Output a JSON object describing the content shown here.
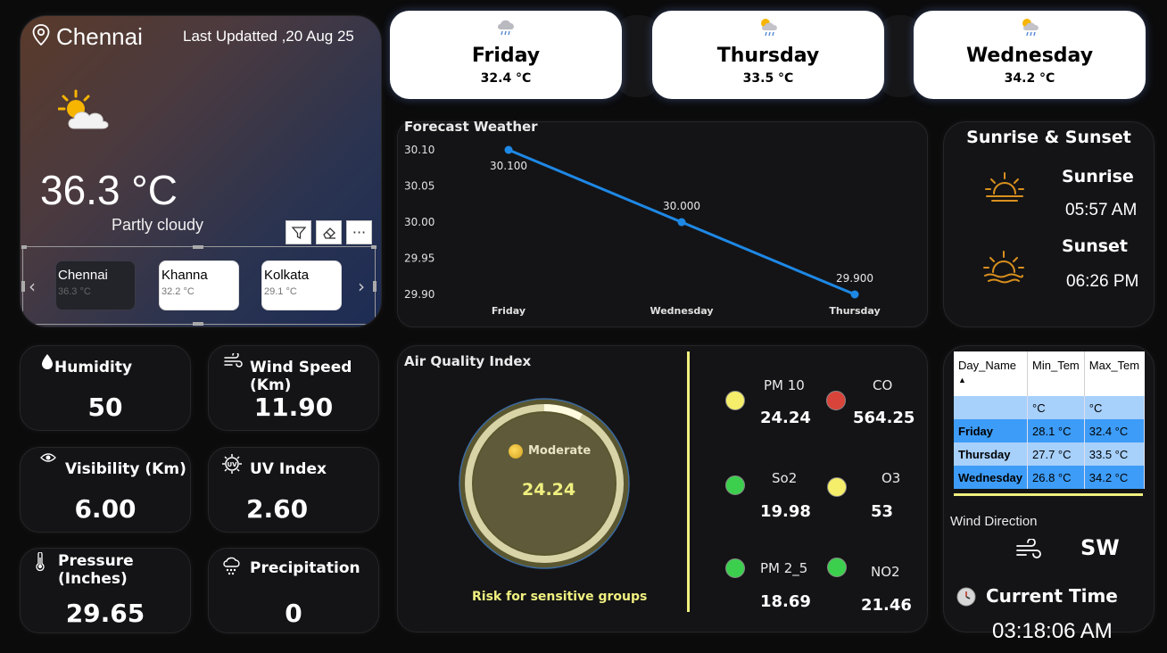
{
  "current": {
    "city": "Chennai",
    "last_updated": "Last Updatted ,20 Aug 25",
    "temperature": "36.3 °C",
    "condition": "Partly cloudy"
  },
  "cities": [
    {
      "name": "Chennai",
      "temp": "36.3 °C",
      "active": true
    },
    {
      "name": "Khanna",
      "temp": "32.2 °C",
      "active": false
    },
    {
      "name": "Kolkata",
      "temp": "29.1 °C",
      "active": false
    }
  ],
  "forecast_days": [
    {
      "day": "Friday",
      "temp": "32.4 °C",
      "icon": "rain-cloud-icon"
    },
    {
      "day": "Thursday",
      "temp": "33.5 °C",
      "icon": "sun-rain-cloud-icon"
    },
    {
      "day": "Wednesday",
      "temp": "34.2 °C",
      "icon": "sun-rain-cloud-icon"
    }
  ],
  "forecast_chart": {
    "title": "Forecast Weather"
  },
  "chart_data": {
    "type": "line",
    "categories": [
      "Friday",
      "Wednesday",
      "Thursday"
    ],
    "values": [
      30.1,
      30.0,
      29.9
    ],
    "data_labels": [
      "30.100",
      "30.000",
      "29.900"
    ],
    "yticks": [
      "30.10",
      "30.05",
      "30.00",
      "29.95",
      "29.90"
    ],
    "ylim": [
      29.9,
      30.1
    ],
    "color": "#1e88e5",
    "grid": false
  },
  "sun": {
    "title": "Sunrise & Sunset",
    "sunrise_label": "Sunrise",
    "sunrise_time": "05:57 AM",
    "sunset_label": "Sunset",
    "sunset_time": "06:26 PM",
    "icon_color": "#d9901e"
  },
  "stats": {
    "humidity": {
      "label": "Humidity",
      "value": "50"
    },
    "wind_speed": {
      "label": "Wind Speed (Km)",
      "value": "11.90"
    },
    "visibility": {
      "label": "Visibility (Km)",
      "value": "6.00"
    },
    "uv_index": {
      "label": "UV Index",
      "value": "2.60"
    },
    "pressure": {
      "label": "Pressure (Inches)",
      "value": "29.65"
    },
    "precipitation": {
      "label": "Precipitation",
      "value": "0"
    }
  },
  "aqi": {
    "title": "Air Quality Index",
    "level": "Moderate",
    "value": "24.24",
    "gauge_fraction": 0.08,
    "note": "Risk for sensitive groups",
    "accent": "#f0f080",
    "pollutants": [
      {
        "name": "PM 10",
        "value": "24.24",
        "color": "#f5ee6a"
      },
      {
        "name": "CO",
        "value": "564.25",
        "color": "#d8443a"
      },
      {
        "name": "So2",
        "value": "19.98",
        "color": "#3ccf4e"
      },
      {
        "name": "O3",
        "value": "53",
        "color": "#f5ee6a"
      },
      {
        "name": "PM 2_5",
        "value": "18.69",
        "color": "#3ccf4e"
      },
      {
        "name": "NO2",
        "value": "21.46",
        "color": "#3ccf4e"
      }
    ]
  },
  "temp_table": {
    "headers": [
      "Day_Name",
      "Min_Tem",
      "Max_Tem"
    ],
    "units": [
      "",
      "°C",
      "°C"
    ],
    "rows": [
      [
        "Friday",
        "28.1 °C",
        "32.4 °C"
      ],
      [
        "Thursday",
        "27.7 °C",
        "33.5 °C"
      ],
      [
        "Wednesday",
        "26.8 °C",
        "34.2 °C"
      ]
    ]
  },
  "wind": {
    "label": "Wind Direction",
    "direction": "SW"
  },
  "clock": {
    "label": "Current Time",
    "time": "03:18:06 AM"
  }
}
